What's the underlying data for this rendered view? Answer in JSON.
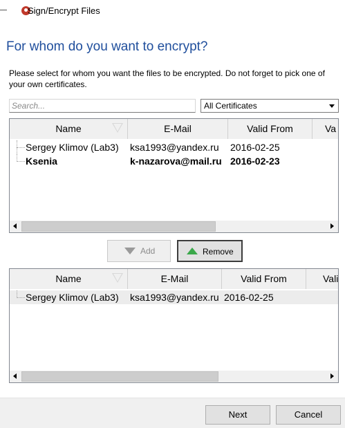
{
  "window": {
    "title": "Sign/Encrypt Files",
    "icon": "app-logo-icon"
  },
  "page": {
    "heading": "For whom do you want to encrypt?",
    "instructions": "Please select for whom you want the files to be encrypted. Do not forget to pick one of your own certificates."
  },
  "filter": {
    "search_placeholder": "Search...",
    "certificate_filter": "All Certificates"
  },
  "available": {
    "columns": [
      "Name",
      "E-Mail",
      "Valid From",
      "Va"
    ],
    "rows": [
      {
        "name": "Sergey Klimov (Lab3)",
        "email": "ksa1993@yandex.ru",
        "valid_from": "2016-02-25"
      },
      {
        "name": "Ksenia",
        "email": "k-nazarova@mail.ru",
        "valid_from": "2016-02-23"
      }
    ]
  },
  "actions": {
    "add_label": "Add",
    "remove_label": "Remove"
  },
  "selected": {
    "columns": [
      "Name",
      "E-Mail",
      "Valid From",
      "Vali"
    ],
    "rows": [
      {
        "name": "Sergey Klimov (Lab3)",
        "email": "ksa1993@yandex.ru",
        "valid_from": "2016-02-25"
      }
    ]
  },
  "footer": {
    "next_label": "Next",
    "cancel_label": "Cancel"
  },
  "colors": {
    "heading": "#1f4e9c",
    "remove_icon": "#3aa84a"
  }
}
